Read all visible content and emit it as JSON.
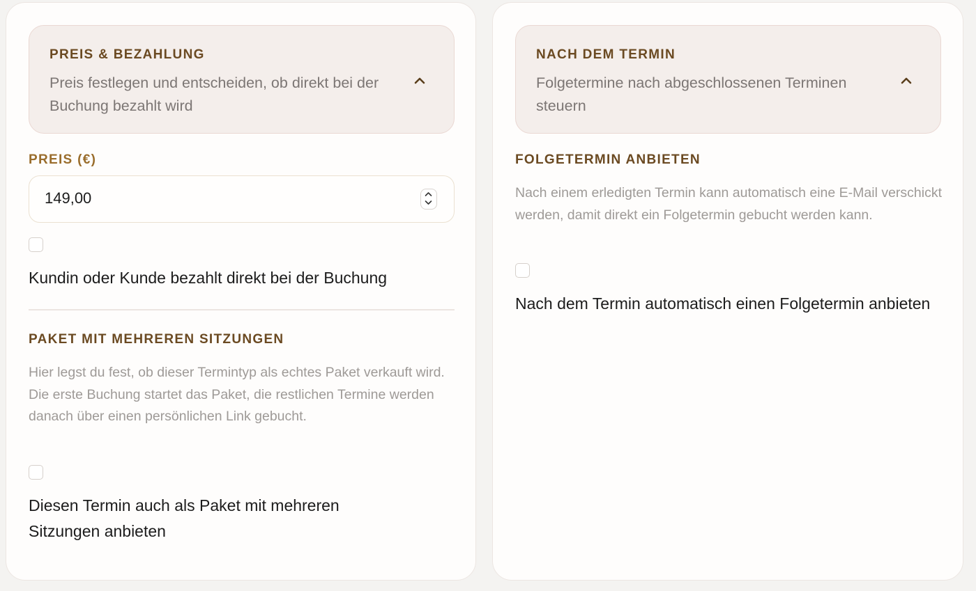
{
  "left": {
    "payment_section": {
      "title": "PREIS & BEZAHLUNG",
      "subtitle": "Preis festlegen und entscheiden, ob direkt bei der Buchung bezahlt wird",
      "icon": "chevron-up-icon"
    },
    "price": {
      "label": "PREIS (€)",
      "value": "149,00"
    },
    "pay_direct": {
      "checked": false,
      "label": "Kundin oder Kunde bezahlt direkt bei der Buchung"
    },
    "package": {
      "title": "PAKET MIT MEHREREN SITZUNGEN",
      "help": "Hier legst du fest, ob dieser Termintyp als echtes Paket verkauft wird. Die erste Buchung startet das Paket, die restlichen Termine werden danach über einen persönlichen Link gebucht.",
      "checked": false,
      "label": "Diesen Termin auch als Paket mit mehreren Sitzungen anbieten"
    }
  },
  "right": {
    "after_section": {
      "title": "NACH DEM TERMIN",
      "subtitle": "Folgetermine nach abgeschlossenen Terminen steuern",
      "icon": "chevron-up-icon"
    },
    "followup": {
      "title": "FOLGETERMIN ANBIETEN",
      "help": "Nach einem erledigten Termin kann automatisch eine E-Mail verschickt werden, damit direkt ein Folgetermin gebucht werden kann.",
      "checked": false,
      "label": "Nach dem Termin automatisch einen Folgetermin anbieten"
    }
  },
  "colors": {
    "accent_dark": "#6b4a22",
    "accent_gold": "#9a6d2c",
    "header_bg": "#f4eeeb"
  }
}
